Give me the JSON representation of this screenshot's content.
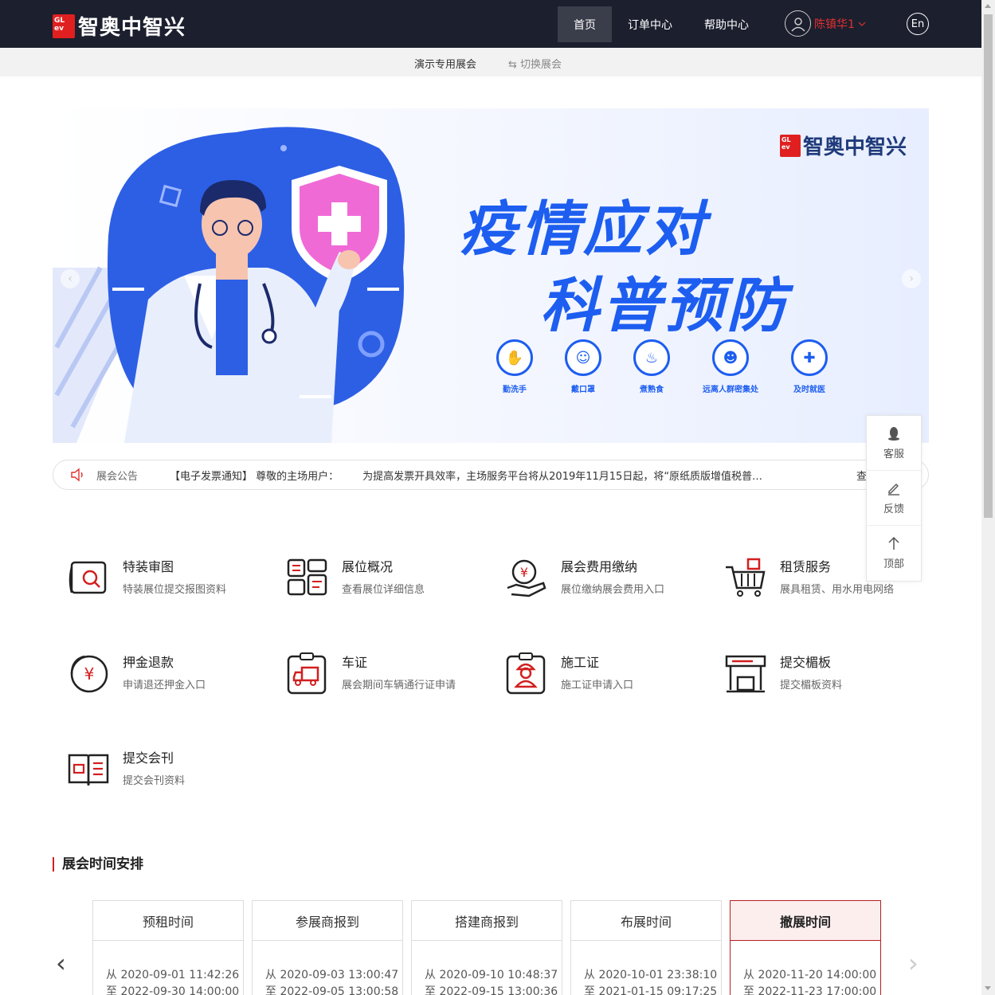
{
  "header": {
    "logo_mark": "GL events",
    "logo_text": "智奥中智兴",
    "nav": [
      {
        "label": "首页",
        "active": true
      },
      {
        "label": "订单中心",
        "active": false
      },
      {
        "label": "帮助中心",
        "active": false
      }
    ],
    "user_name": "陈镇华1",
    "lang": "En"
  },
  "subbar": {
    "expo_name": "演示专用展会",
    "switch_label": "切换展会"
  },
  "banner": {
    "logo_text": "智奥中智兴",
    "headline_1": "疫情应对",
    "headline_2": "科普预防",
    "tips": [
      "勤洗手",
      "戴口罩",
      "煮熟食",
      "远离人群密集处",
      "及时就医"
    ]
  },
  "notice": {
    "label": "展会公告",
    "title": "【电子发票通知】 尊敬的主场用户：",
    "body": "为提高发票开具效率，主场服务平台将从2019年11月15日起，将“原纸质版增值税普…",
    "more": "查"
  },
  "float_panel": {
    "items": [
      "客服",
      "反馈",
      "顶部"
    ]
  },
  "services": [
    {
      "title": "特装审图",
      "desc": "特装展位提交报图资料",
      "icon": "blueprint-icon"
    },
    {
      "title": "展位概况",
      "desc": "查看展位详细信息",
      "icon": "booth-layout-icon"
    },
    {
      "title": "展会费用缴纳",
      "desc": "展位缴纳展会费用入口",
      "icon": "payment-hand-icon"
    },
    {
      "title": "租赁服务",
      "desc": "展具租赁、用水用电网络",
      "icon": "cart-icon"
    },
    {
      "title": "押金退款",
      "desc": "申请退还押金入口",
      "icon": "refund-icon"
    },
    {
      "title": "车证",
      "desc": "展会期间车辆通行证申请",
      "icon": "truck-pass-icon"
    },
    {
      "title": "施工证",
      "desc": "施工证申请入口",
      "icon": "worker-pass-icon"
    },
    {
      "title": "提交楣板",
      "desc": "提交楣板资料",
      "icon": "fascia-board-icon"
    },
    {
      "title": "提交会刊",
      "desc": "提交会刊资料",
      "icon": "catalog-book-icon"
    }
  ],
  "schedule": {
    "title": "展会时间安排",
    "cards": [
      {
        "name": "预租时间",
        "from": "从 2020-09-01 11:42:26",
        "to": "至 2022-09-30 14:00:00",
        "active": false
      },
      {
        "name": "参展商报到",
        "from": "从 2020-09-03 13:00:47",
        "to": "至 2022-09-05 13:00:58",
        "active": false
      },
      {
        "name": "搭建商报到",
        "from": "从 2020-09-10 10:48:37",
        "to": "至 2022-09-15 13:00:36",
        "active": false
      },
      {
        "name": "布展时间",
        "from": "从 2020-10-01 23:38:10",
        "to": "至 2021-01-15 09:17:25",
        "active": false
      },
      {
        "name": "撤展时间",
        "from": "从 2020-11-20 14:00:00",
        "to": "至 2022-11-23 17:00:00",
        "active": true
      }
    ]
  },
  "colors": {
    "header_bg": "#1c1f2e",
    "accent_red": "#d21f1f",
    "banner_blue": "#1d5ef0"
  }
}
